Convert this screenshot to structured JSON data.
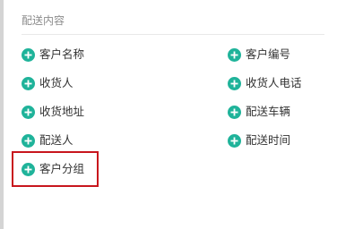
{
  "section": {
    "title": "配送内容"
  },
  "colors": {
    "icon_green": "#1fb39a",
    "highlight_red": "#c8161d",
    "label_text": "#333333",
    "title_text": "#8c8c8c"
  },
  "fields": {
    "customer_name": "客户名称",
    "customer_code": "客户编号",
    "receiver": "收货人",
    "receiver_phone": "收货人电话",
    "delivery_address": "收货地址",
    "delivery_vehicle": "配送车辆",
    "delivery_person": "配送人",
    "delivery_time": "配送时间",
    "customer_group": "客户分组"
  },
  "icons": {
    "add": "plus-circle-icon"
  },
  "highlighted_field": "customer_group"
}
